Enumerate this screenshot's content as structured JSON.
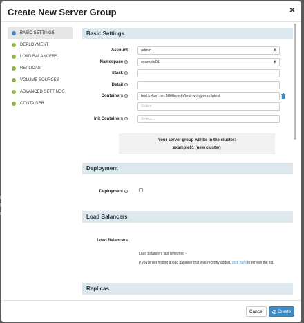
{
  "modal": {
    "title": "Create New Server Group"
  },
  "nav": {
    "items": [
      {
        "label": "BASIC SETTINGS",
        "active": true
      },
      {
        "label": "DEPLOYMENT"
      },
      {
        "label": "LOAD BALANCERS"
      },
      {
        "label": "REPLICAS"
      },
      {
        "label": "VOLUME SOURCES"
      },
      {
        "label": "ADVANCED SETTINGS"
      },
      {
        "label": "CONTAINER"
      }
    ]
  },
  "basic": {
    "title": "Basic Settings",
    "account_label": "Account",
    "account_value": "admin",
    "namespace_label": "Namespace",
    "namespace_value": "example01",
    "stack_label": "Stack",
    "stack_value": "",
    "detail_label": "Detail",
    "detail_value": "",
    "containers_label": "Containers",
    "containers_value": "test.hylom.net:5000/oscin/test-wordpress:latest",
    "containers_placeholder": "Select...",
    "init_label": "Init Containers",
    "init_placeholder": "Select...",
    "cluster_line": "Your server group will be in the cluster:",
    "cluster_name": "example01 (new cluster)"
  },
  "deployment": {
    "title": "Deployment",
    "label": "Deployment",
    "checked": false
  },
  "load_balancers": {
    "title": "Load Balancers",
    "label": "Load Balancers",
    "refreshed": "Load balancers last refreshed -",
    "hint_before": "If you're not finding a load balancer that was recently added,",
    "hint_link": "click here",
    "hint_after": "to refresh the list."
  },
  "replicas": {
    "title": "Replicas"
  },
  "footer": {
    "cancel_label": "Cancel",
    "create_label": "Create"
  },
  "colors": {
    "accent": "#3d8bc4",
    "section_bg": "#dce7ee",
    "nav_dot": "#8cb24a"
  }
}
